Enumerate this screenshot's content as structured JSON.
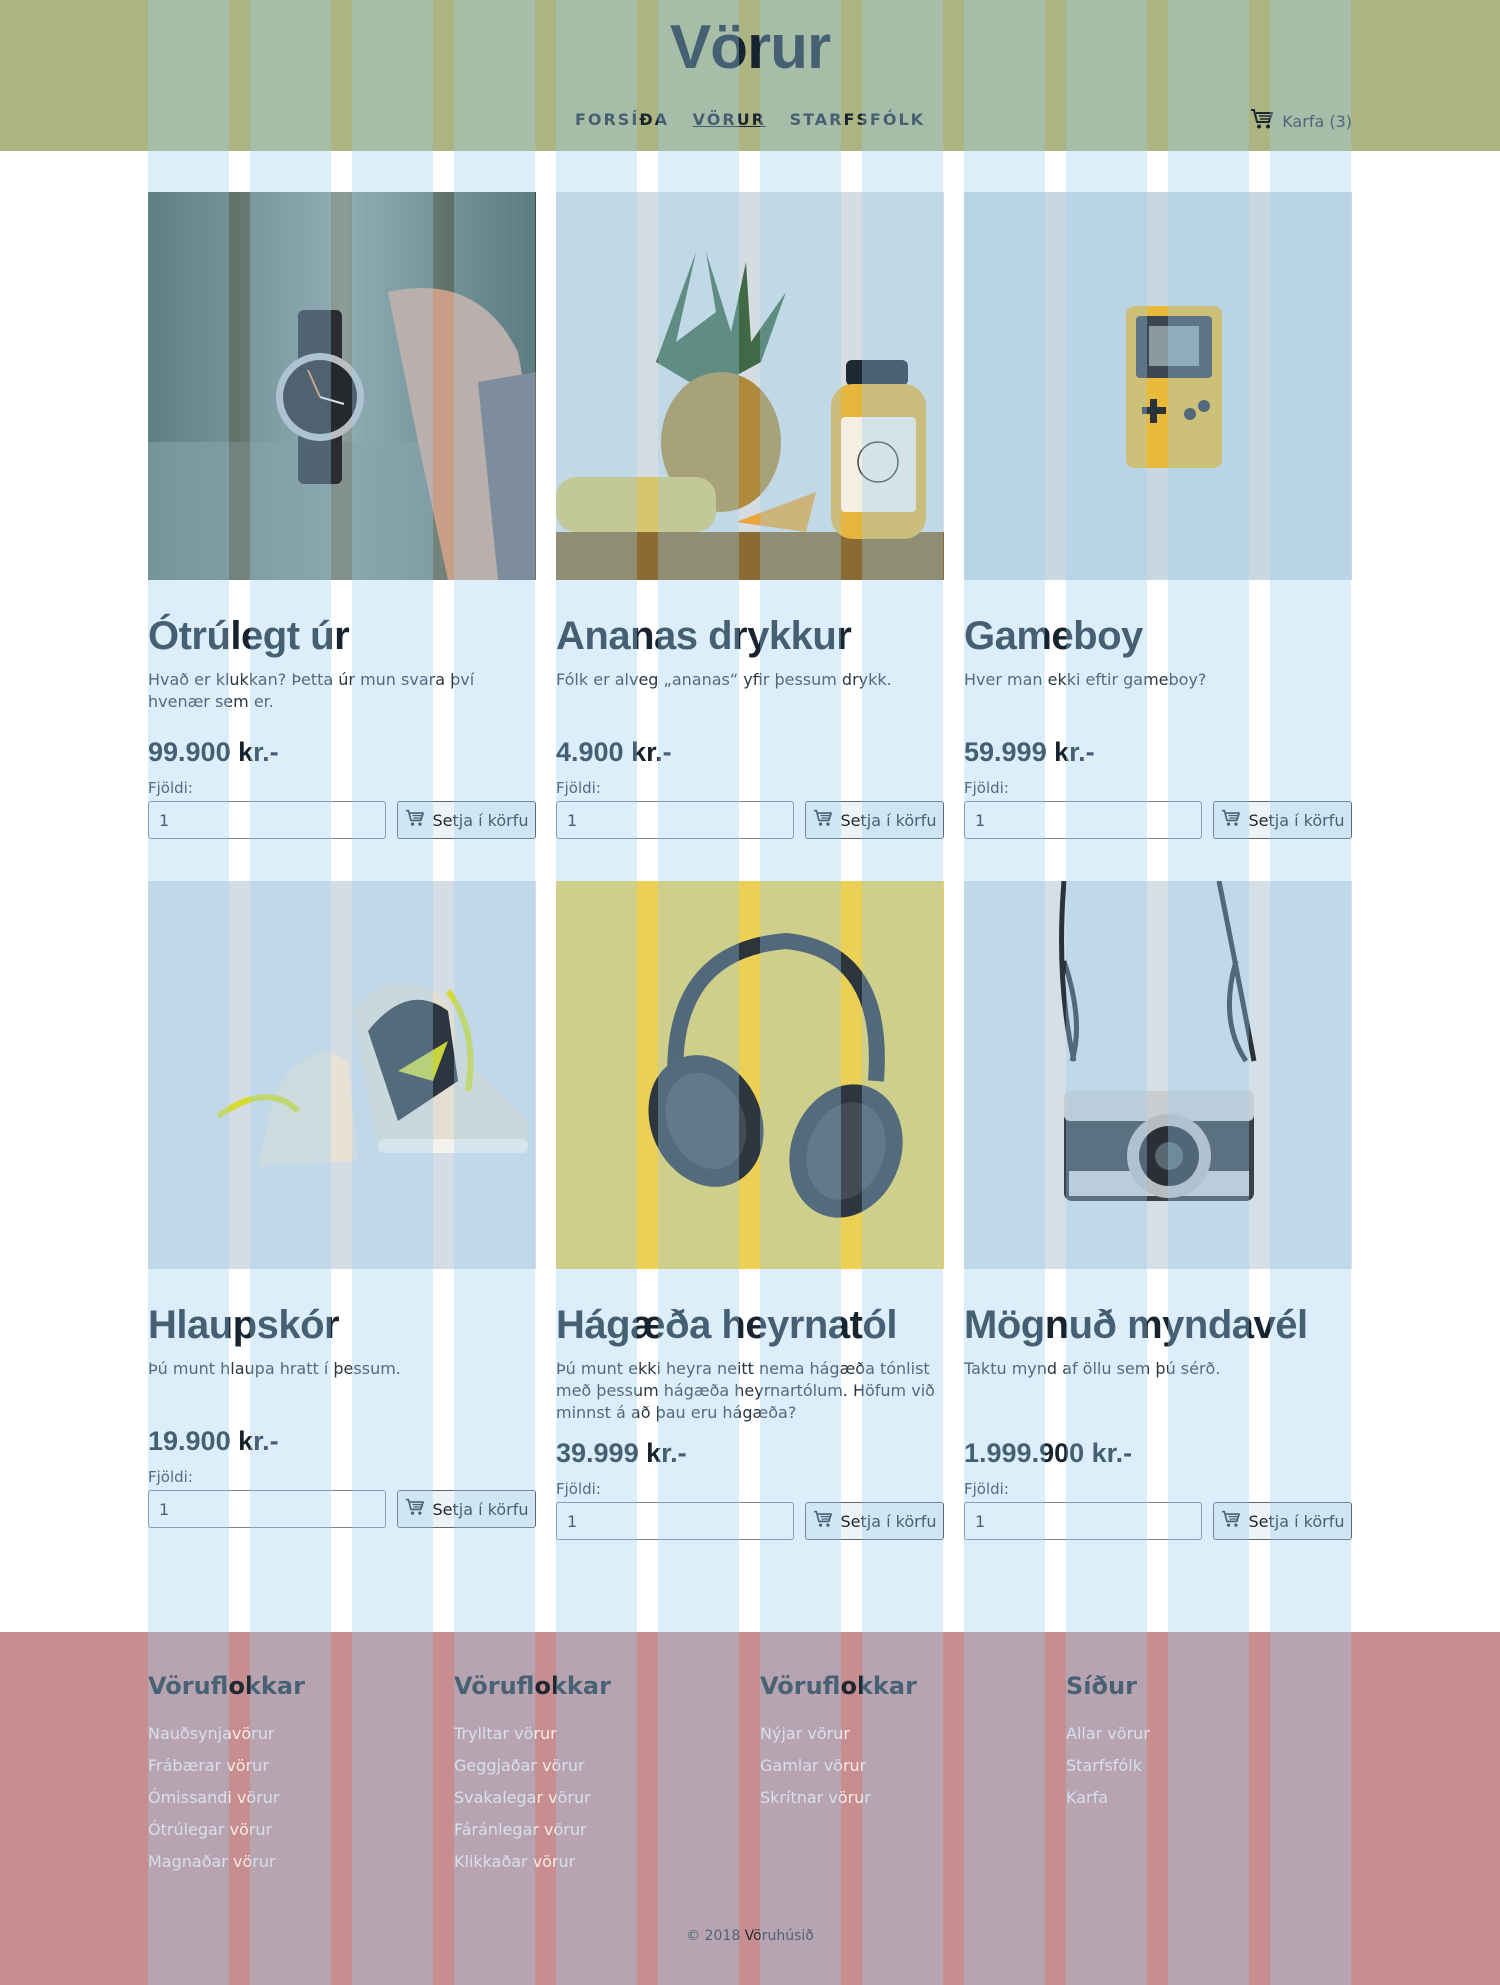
{
  "header": {
    "title": "Vörur",
    "nav": [
      {
        "label": "FORSÍÐA",
        "active": false
      },
      {
        "label": "VÖRUR",
        "active": true
      },
      {
        "label": "STARFSFÓLK",
        "active": false
      }
    ],
    "cart_label": "Karfa (3)",
    "cart_icon": "cart-icon"
  },
  "products": [
    {
      "name": "Ótrúlegt úr",
      "description": "Hvað er klukkan? Þetta úr mun svara því hvenær sem er.",
      "price": "99.900 kr.-",
      "qty_label": "Fjöldi:",
      "qty": "1",
      "button": "Setja í körfu"
    },
    {
      "name": "Ananas drykkur",
      "description": "Fólk er alveg „ananas“ yfir þessum drykk.",
      "price": "4.900 kr.-",
      "qty_label": "Fjöldi:",
      "qty": "1",
      "button": "Setja í körfu"
    },
    {
      "name": "Gameboy",
      "description": "Hver man ekki eftir gameboy?",
      "price": "59.999 kr.-",
      "qty_label": "Fjöldi:",
      "qty": "1",
      "button": "Setja í körfu"
    },
    {
      "name": "Hlaupskór",
      "description": "Þú munt hlaupa hratt í þessum.",
      "price": "19.900 kr.-",
      "qty_label": "Fjöldi:",
      "qty": "1",
      "button": "Setja í körfu"
    },
    {
      "name": "Hágæða heyrnatól",
      "description": "Þú munt ekki heyra neitt nema hágæða tónlist með þessum hágæða heyrnartólum. Höfum við minnst á að þau eru hágæða?",
      "price": "39.999 kr.-",
      "qty_label": "Fjöldi:",
      "qty": "1",
      "button": "Setja í körfu"
    },
    {
      "name": "Mögnuð myndavél",
      "description": "Taktu mynd af öllu sem þú sérð.",
      "price": "1.999.900 kr.-",
      "qty_label": "Fjöldi:",
      "qty": "1",
      "button": "Setja í körfu"
    }
  ],
  "footer": {
    "columns": [
      {
        "heading": "Vöruflokkar",
        "links": [
          "Nauðsynjavörur",
          "Frábærar vörur",
          "Ómissandi vörur",
          "Ótrúlegar vörur",
          "Magnaðar vörur"
        ]
      },
      {
        "heading": "Vöruflokkar",
        "links": [
          "Trylltar vörur",
          "Geggjaðar vörur",
          "Svakalegar vörur",
          "Fáránlegar vörur",
          "Klikkaðar vörur"
        ]
      },
      {
        "heading": "Vöruflokkar",
        "links": [
          "Nýjar vörur",
          "Gamlar vörur",
          "Skrítnar vörur"
        ]
      },
      {
        "heading": "Síður",
        "links": [
          "Allar vörur",
          "Starfsfólk",
          "Karfa"
        ]
      }
    ],
    "copyright": "© 2018 Vöruhúsið"
  },
  "colors": {
    "header_bg": "#adb482",
    "footer_bg": "#c88e8f",
    "overlay_columns": "#9bcdf0",
    "text_dark": "#172430"
  }
}
